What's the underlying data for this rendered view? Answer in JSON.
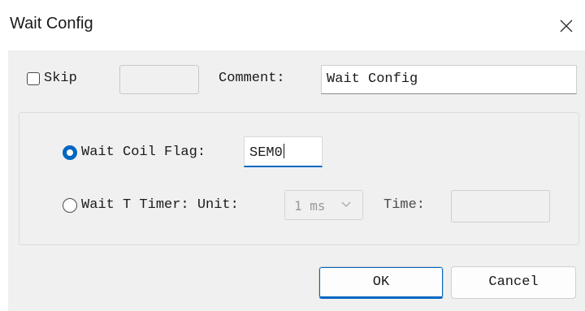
{
  "dialog": {
    "title": "Wait Config",
    "close_icon": "close-icon"
  },
  "skip": {
    "label": "Skip",
    "checked": false,
    "value": ""
  },
  "comment": {
    "label": "Comment:",
    "value": "Wait Config"
  },
  "wait_options": {
    "coil": {
      "label": "Wait Coil Flag:",
      "selected": true,
      "value": "SEM0"
    },
    "timer": {
      "label": "Wait T Timer: Unit:",
      "selected": false,
      "unit_value": "1 ms",
      "time_label": "Time:",
      "time_value": ""
    }
  },
  "buttons": {
    "ok_label": "OK",
    "cancel_label": "Cancel"
  },
  "colors": {
    "accent": "#0067c0",
    "body_bg": "#f0f0f0",
    "title_bg": "#ffffff"
  }
}
